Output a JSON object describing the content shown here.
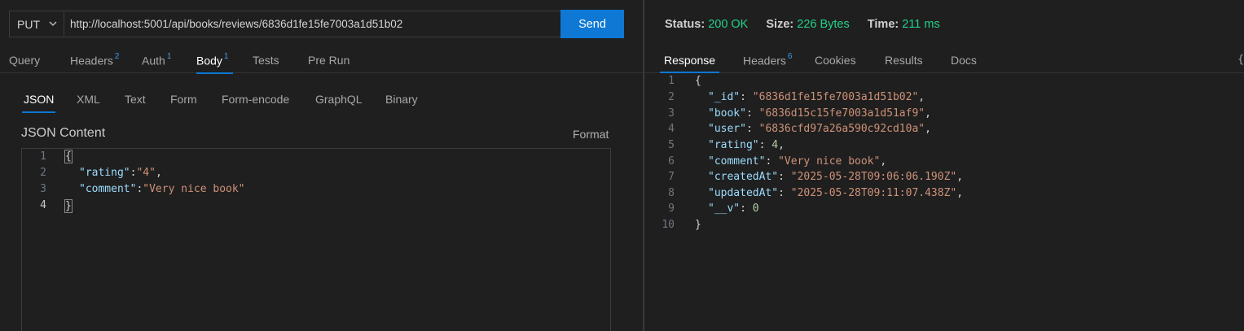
{
  "request": {
    "method": "PUT",
    "url": "http://localhost:5001/api/books/reviews/6836d1fe15fe7003a1d51b02",
    "send_label": "Send",
    "tabs": [
      {
        "label": "Query",
        "badge": ""
      },
      {
        "label": "Headers",
        "badge": "2"
      },
      {
        "label": "Auth",
        "badge": "1"
      },
      {
        "label": "Body",
        "badge": "1"
      },
      {
        "label": "Tests",
        "badge": ""
      },
      {
        "label": "Pre Run",
        "badge": ""
      }
    ],
    "active_tab": "Body",
    "body_types": [
      "JSON",
      "XML",
      "Text",
      "Form",
      "Form-encode",
      "GraphQL",
      "Binary"
    ],
    "active_body_type": "JSON",
    "content_title": "JSON Content",
    "format_label": "Format",
    "body_lines": [
      {
        "num": "1",
        "text": "{"
      },
      {
        "num": "2",
        "key": "\"rating\"",
        "sep": ":",
        "value": "\"4\"",
        "end": ","
      },
      {
        "num": "3",
        "key": "\"comment\"",
        "sep": ":",
        "value": "\"Very nice book\"",
        "end": ""
      },
      {
        "num": "4",
        "text": "}"
      }
    ]
  },
  "response": {
    "status_label": "Status:",
    "status_value": "200 OK",
    "size_label": "Size:",
    "size_value": "226 Bytes",
    "time_label": "Time:",
    "time_value": "211 ms",
    "tabs": [
      {
        "label": "Response",
        "badge": ""
      },
      {
        "label": "Headers",
        "badge": "6"
      },
      {
        "label": "Cookies",
        "badge": ""
      },
      {
        "label": "Results",
        "badge": ""
      },
      {
        "label": "Docs",
        "badge": ""
      }
    ],
    "active_tab": "Response",
    "lines": [
      {
        "num": "1",
        "text": "{"
      },
      {
        "num": "2",
        "key": "\"_id\"",
        "value": "\"6836d1fe15fe7003a1d51b02\"",
        "type": "s",
        "end": ","
      },
      {
        "num": "3",
        "key": "\"book\"",
        "value": "\"6836d15c15fe7003a1d51af9\"",
        "type": "s",
        "end": ","
      },
      {
        "num": "4",
        "key": "\"user\"",
        "value": "\"6836cfd97a26a590c92cd10a\"",
        "type": "s",
        "end": ","
      },
      {
        "num": "5",
        "key": "\"rating\"",
        "value": "4",
        "type": "n",
        "end": ","
      },
      {
        "num": "6",
        "key": "\"comment\"",
        "value": "\"Very nice book\"",
        "type": "s",
        "end": ","
      },
      {
        "num": "7",
        "key": "\"createdAt\"",
        "value": "\"2025-05-28T09:06:06.190Z\"",
        "type": "s",
        "end": ","
      },
      {
        "num": "8",
        "key": "\"updatedAt\"",
        "value": "\"2025-05-28T09:11:07.438Z\"",
        "type": "s",
        "end": ","
      },
      {
        "num": "9",
        "key": "\"__v\"",
        "value": "0",
        "type": "n",
        "end": ""
      },
      {
        "num": "10",
        "text": "}"
      }
    ],
    "edge_glyph": "{"
  },
  "colors": {
    "accent": "#0e78d4",
    "status_green": "#23d18b",
    "json_key": "#9cdcfe",
    "json_string": "#ce9178",
    "json_number": "#b5cea8"
  }
}
